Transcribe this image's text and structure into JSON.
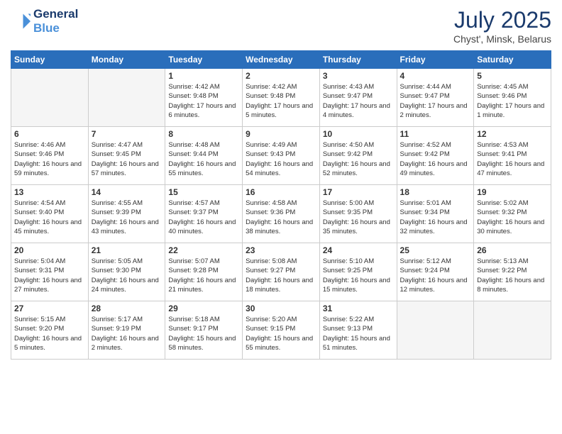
{
  "header": {
    "logo_line1": "General",
    "logo_line2": "Blue",
    "month": "July 2025",
    "location": "Chyst', Minsk, Belarus"
  },
  "weekdays": [
    "Sunday",
    "Monday",
    "Tuesday",
    "Wednesday",
    "Thursday",
    "Friday",
    "Saturday"
  ],
  "weeks": [
    [
      {
        "day": "",
        "sunrise": "",
        "sunset": "",
        "daylight": ""
      },
      {
        "day": "",
        "sunrise": "",
        "sunset": "",
        "daylight": ""
      },
      {
        "day": "1",
        "sunrise": "Sunrise: 4:42 AM",
        "sunset": "Sunset: 9:48 PM",
        "daylight": "Daylight: 17 hours and 6 minutes."
      },
      {
        "day": "2",
        "sunrise": "Sunrise: 4:42 AM",
        "sunset": "Sunset: 9:48 PM",
        "daylight": "Daylight: 17 hours and 5 minutes."
      },
      {
        "day": "3",
        "sunrise": "Sunrise: 4:43 AM",
        "sunset": "Sunset: 9:47 PM",
        "daylight": "Daylight: 17 hours and 4 minutes."
      },
      {
        "day": "4",
        "sunrise": "Sunrise: 4:44 AM",
        "sunset": "Sunset: 9:47 PM",
        "daylight": "Daylight: 17 hours and 2 minutes."
      },
      {
        "day": "5",
        "sunrise": "Sunrise: 4:45 AM",
        "sunset": "Sunset: 9:46 PM",
        "daylight": "Daylight: 17 hours and 1 minute."
      }
    ],
    [
      {
        "day": "6",
        "sunrise": "Sunrise: 4:46 AM",
        "sunset": "Sunset: 9:46 PM",
        "daylight": "Daylight: 16 hours and 59 minutes."
      },
      {
        "day": "7",
        "sunrise": "Sunrise: 4:47 AM",
        "sunset": "Sunset: 9:45 PM",
        "daylight": "Daylight: 16 hours and 57 minutes."
      },
      {
        "day": "8",
        "sunrise": "Sunrise: 4:48 AM",
        "sunset": "Sunset: 9:44 PM",
        "daylight": "Daylight: 16 hours and 55 minutes."
      },
      {
        "day": "9",
        "sunrise": "Sunrise: 4:49 AM",
        "sunset": "Sunset: 9:43 PM",
        "daylight": "Daylight: 16 hours and 54 minutes."
      },
      {
        "day": "10",
        "sunrise": "Sunrise: 4:50 AM",
        "sunset": "Sunset: 9:42 PM",
        "daylight": "Daylight: 16 hours and 52 minutes."
      },
      {
        "day": "11",
        "sunrise": "Sunrise: 4:52 AM",
        "sunset": "Sunset: 9:42 PM",
        "daylight": "Daylight: 16 hours and 49 minutes."
      },
      {
        "day": "12",
        "sunrise": "Sunrise: 4:53 AM",
        "sunset": "Sunset: 9:41 PM",
        "daylight": "Daylight: 16 hours and 47 minutes."
      }
    ],
    [
      {
        "day": "13",
        "sunrise": "Sunrise: 4:54 AM",
        "sunset": "Sunset: 9:40 PM",
        "daylight": "Daylight: 16 hours and 45 minutes."
      },
      {
        "day": "14",
        "sunrise": "Sunrise: 4:55 AM",
        "sunset": "Sunset: 9:39 PM",
        "daylight": "Daylight: 16 hours and 43 minutes."
      },
      {
        "day": "15",
        "sunrise": "Sunrise: 4:57 AM",
        "sunset": "Sunset: 9:37 PM",
        "daylight": "Daylight: 16 hours and 40 minutes."
      },
      {
        "day": "16",
        "sunrise": "Sunrise: 4:58 AM",
        "sunset": "Sunset: 9:36 PM",
        "daylight": "Daylight: 16 hours and 38 minutes."
      },
      {
        "day": "17",
        "sunrise": "Sunrise: 5:00 AM",
        "sunset": "Sunset: 9:35 PM",
        "daylight": "Daylight: 16 hours and 35 minutes."
      },
      {
        "day": "18",
        "sunrise": "Sunrise: 5:01 AM",
        "sunset": "Sunset: 9:34 PM",
        "daylight": "Daylight: 16 hours and 32 minutes."
      },
      {
        "day": "19",
        "sunrise": "Sunrise: 5:02 AM",
        "sunset": "Sunset: 9:32 PM",
        "daylight": "Daylight: 16 hours and 30 minutes."
      }
    ],
    [
      {
        "day": "20",
        "sunrise": "Sunrise: 5:04 AM",
        "sunset": "Sunset: 9:31 PM",
        "daylight": "Daylight: 16 hours and 27 minutes."
      },
      {
        "day": "21",
        "sunrise": "Sunrise: 5:05 AM",
        "sunset": "Sunset: 9:30 PM",
        "daylight": "Daylight: 16 hours and 24 minutes."
      },
      {
        "day": "22",
        "sunrise": "Sunrise: 5:07 AM",
        "sunset": "Sunset: 9:28 PM",
        "daylight": "Daylight: 16 hours and 21 minutes."
      },
      {
        "day": "23",
        "sunrise": "Sunrise: 5:08 AM",
        "sunset": "Sunset: 9:27 PM",
        "daylight": "Daylight: 16 hours and 18 minutes."
      },
      {
        "day": "24",
        "sunrise": "Sunrise: 5:10 AM",
        "sunset": "Sunset: 9:25 PM",
        "daylight": "Daylight: 16 hours and 15 minutes."
      },
      {
        "day": "25",
        "sunrise": "Sunrise: 5:12 AM",
        "sunset": "Sunset: 9:24 PM",
        "daylight": "Daylight: 16 hours and 12 minutes."
      },
      {
        "day": "26",
        "sunrise": "Sunrise: 5:13 AM",
        "sunset": "Sunset: 9:22 PM",
        "daylight": "Daylight: 16 hours and 8 minutes."
      }
    ],
    [
      {
        "day": "27",
        "sunrise": "Sunrise: 5:15 AM",
        "sunset": "Sunset: 9:20 PM",
        "daylight": "Daylight: 16 hours and 5 minutes."
      },
      {
        "day": "28",
        "sunrise": "Sunrise: 5:17 AM",
        "sunset": "Sunset: 9:19 PM",
        "daylight": "Daylight: 16 hours and 2 minutes."
      },
      {
        "day": "29",
        "sunrise": "Sunrise: 5:18 AM",
        "sunset": "Sunset: 9:17 PM",
        "daylight": "Daylight: 15 hours and 58 minutes."
      },
      {
        "day": "30",
        "sunrise": "Sunrise: 5:20 AM",
        "sunset": "Sunset: 9:15 PM",
        "daylight": "Daylight: 15 hours and 55 minutes."
      },
      {
        "day": "31",
        "sunrise": "Sunrise: 5:22 AM",
        "sunset": "Sunset: 9:13 PM",
        "daylight": "Daylight: 15 hours and 51 minutes."
      },
      {
        "day": "",
        "sunrise": "",
        "sunset": "",
        "daylight": ""
      },
      {
        "day": "",
        "sunrise": "",
        "sunset": "",
        "daylight": ""
      }
    ]
  ]
}
